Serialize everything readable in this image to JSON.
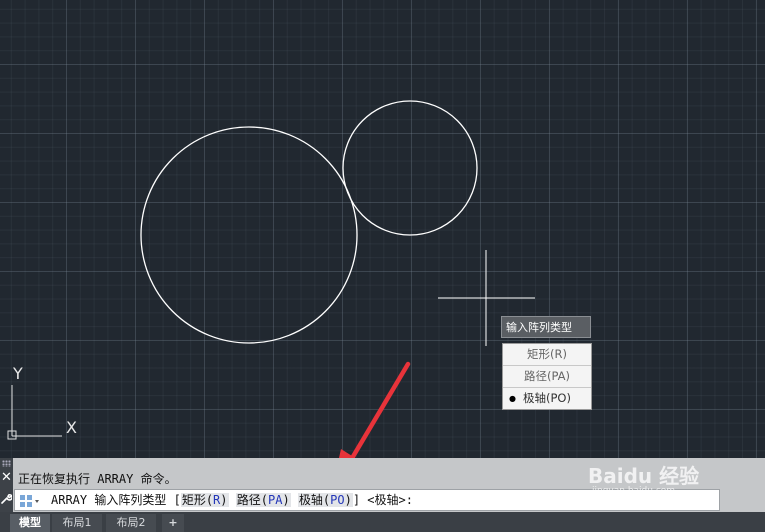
{
  "canvas": {
    "ucs": {
      "x_label": "X",
      "y_label": "Y"
    }
  },
  "dynamic_input": {
    "title": "输入阵列类型",
    "options": [
      {
        "label": "矩形(R)",
        "selected": false
      },
      {
        "label": "路径(PA)",
        "selected": false
      },
      {
        "label": "极轴(PO)",
        "selected": true
      }
    ],
    "bullet": "●"
  },
  "command_window": {
    "history": "正在恢复执行 ARRAY 命令。",
    "prompt_prefix": "ARRAY 输入阵列类型 [",
    "options": [
      {
        "text": "矩形(",
        "key": "R",
        "close": ")"
      },
      {
        "text": "路径(",
        "key": "PA",
        "close": ")"
      },
      {
        "text": "极轴(",
        "key": "PO",
        "close": ")"
      }
    ],
    "prompt_suffix": "] <极轴>:",
    "close_glyph": "✕",
    "wrench_glyph": "🔧"
  },
  "tabs": [
    {
      "label": "模型",
      "active": true
    },
    {
      "label": "布局1",
      "active": false
    },
    {
      "label": "布局2",
      "active": false
    },
    {
      "label": "+",
      "active": false
    }
  ],
  "watermark": {
    "brand": "Baidu 经验",
    "url": "jingyan.baidu.com"
  },
  "colors": {
    "canvas_bg": "#212830",
    "geometry": "#ffffff",
    "arrow": "#e8333a",
    "option_key": "#2336b8"
  },
  "icons": [
    "close-icon",
    "wrench-icon",
    "command-icon",
    "arrow-annotation",
    "crosshair-cursor",
    "ucs-icon"
  ]
}
